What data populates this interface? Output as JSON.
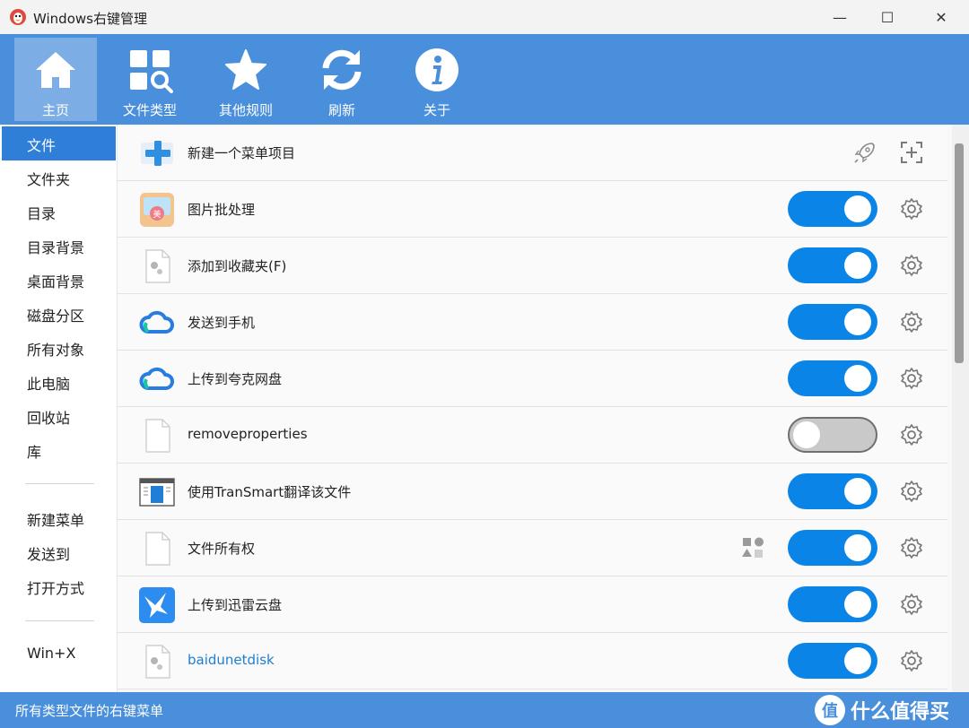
{
  "window": {
    "title": "Windows右键管理",
    "minimize_glyph": "—",
    "maximize_glyph": "☐",
    "close_glyph": "✕"
  },
  "toolbar": {
    "items": [
      {
        "label": "主页",
        "icon": "home-icon",
        "active": true
      },
      {
        "label": "文件类型",
        "icon": "file-type-search-icon",
        "active": false
      },
      {
        "label": "其他规则",
        "icon": "star-icon",
        "active": false
      },
      {
        "label": "刷新",
        "icon": "refresh-icon",
        "active": false
      },
      {
        "label": "关于",
        "icon": "info-icon",
        "active": false
      }
    ]
  },
  "sidebar": {
    "items": [
      {
        "label": "文件",
        "active": true
      },
      {
        "label": "文件夹"
      },
      {
        "label": "目录"
      },
      {
        "label": "目录背景"
      },
      {
        "label": "桌面背景"
      },
      {
        "label": "磁盘分区"
      },
      {
        "label": "所有对象"
      },
      {
        "label": "此电脑"
      },
      {
        "label": "回收站"
      },
      {
        "label": "库"
      },
      {
        "label": "新建菜单"
      },
      {
        "label": "发送到"
      },
      {
        "label": "打开方式"
      },
      {
        "label": "Win+X"
      }
    ]
  },
  "main": {
    "rows": [
      {
        "label": "新建一个菜单项目",
        "icon": "add-plus-icon",
        "type": "new"
      },
      {
        "label": "图片批处理",
        "icon": "photo-batch-icon",
        "enabled": true
      },
      {
        "label": "添加到收藏夹(F)",
        "icon": "settings-file-icon",
        "enabled": true
      },
      {
        "label": "发送到手机",
        "icon": "cloud-icon",
        "enabled": true
      },
      {
        "label": "上传到夸克网盘",
        "icon": "cloud-icon",
        "enabled": true
      },
      {
        "label": "removeproperties",
        "icon": "blank-file-icon",
        "enabled": false
      },
      {
        "label": "使用TranSmart翻译该文件",
        "icon": "transmart-icon",
        "enabled": true
      },
      {
        "label": "文件所有权",
        "icon": "blank-file-icon",
        "enabled": true
      },
      {
        "label": "上传到迅雷云盘",
        "icon": "thunder-bird-icon",
        "enabled": true
      },
      {
        "label": "baidunetdisk",
        "icon": "settings-file-icon",
        "enabled": true
      }
    ]
  },
  "statusbar": {
    "text": "所有类型文件的右键菜单",
    "watermark": "什么值得买",
    "watermark_logo": "值"
  },
  "colors": {
    "accent": "#4a8fdb",
    "toggle_on": "#0a84e6",
    "toggle_off": "#c9c9c9"
  }
}
